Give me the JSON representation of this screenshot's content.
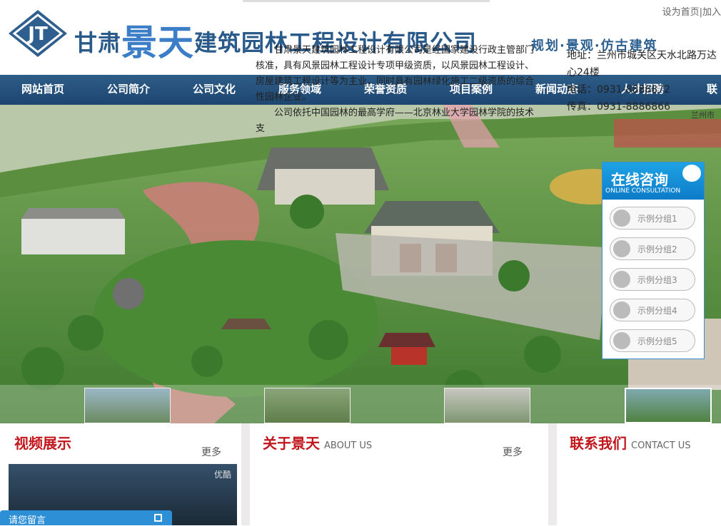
{
  "header": {
    "company_name_prefix": "甘肃",
    "company_name_highlight": "景天",
    "company_name_suffix": "建筑园林工程设计有限公司",
    "slogan": "规划·景观·仿古建筑",
    "top_links": [
      "设为首页",
      "|",
      "加入"
    ]
  },
  "nav": {
    "items": [
      "网站首页",
      "公司简介",
      "公司文化",
      "服务领域",
      "荣誉资质",
      "项目案例",
      "新闻动态",
      "人才招聘",
      "联系"
    ]
  },
  "banner": {
    "corner_text": "兰州市"
  },
  "consult": {
    "title": "在线咨询",
    "subtitle": "ONLINE CONSULTATION",
    "groups": [
      "示例分组1",
      "示例分组2",
      "示例分组3",
      "示例分组4",
      "示例分组5"
    ]
  },
  "video": {
    "title": "视频展示",
    "more": "更多",
    "watermark": "优酷"
  },
  "about": {
    "title": "关于景天",
    "title_en": "ABOUT US",
    "more": "更多",
    "paragraph1": "甘肃景天建筑园林工程设计有限公司是经国家建设行政主管部门核准，具有风景园林工程设计专项甲级资质，以风景园林工程设计、房屋建筑工程设计等为主业，同时具有园林绿化施工二级资质的综合性园林企业。",
    "paragraph2": "公司依托中国园林的最高学府——北京林业大学园林学院的技术支"
  },
  "contact": {
    "title": "联系我们",
    "title_en": "CONTACT US",
    "address": "地址：兰州市城关区天水北路万达",
    "address2": "心24楼",
    "phone": "电话：0931-8886872",
    "fax": "传真：0931-8886866"
  },
  "message_bar": {
    "label": "请您留言"
  },
  "colors": {
    "nav": "#1d4670",
    "accent_red": "#c0161c",
    "consult_blue": "#0d7bc9"
  }
}
